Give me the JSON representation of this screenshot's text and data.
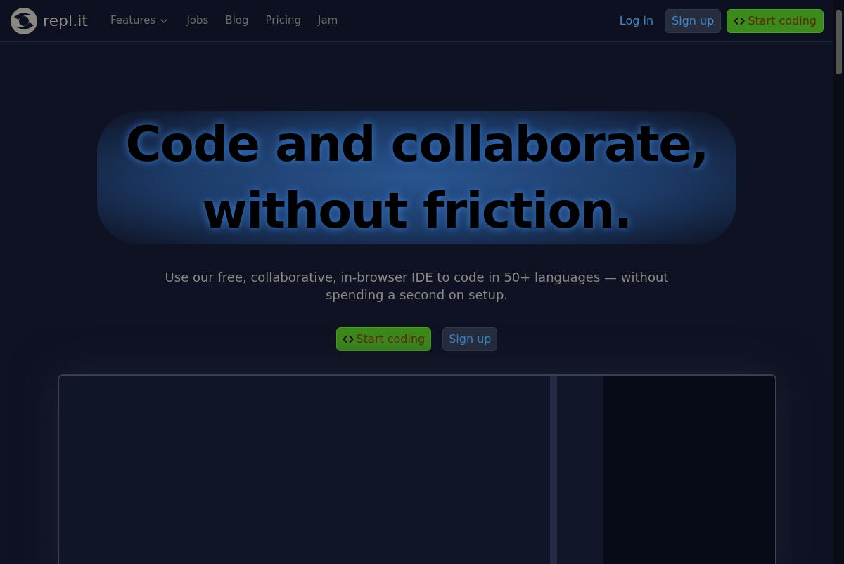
{
  "nav": {
    "logo": "repl.it",
    "links": [
      {
        "label": "Features",
        "dropdown": true
      },
      {
        "label": "Jobs",
        "dropdown": false
      },
      {
        "label": "Blog",
        "dropdown": false
      },
      {
        "label": "Pricing",
        "dropdown": false
      },
      {
        "label": "Jam",
        "dropdown": false
      }
    ],
    "login": "Log in",
    "signup": "Sign up",
    "start": "Start coding"
  },
  "hero": {
    "title_lines": [
      "Code and collaborate,",
      "without friction."
    ],
    "subtitle": "Use our free, collaborative, in-browser IDE to code in 50+ languages — without spending a second on setup.",
    "start": "Start coding",
    "signup": "Sign up"
  }
}
